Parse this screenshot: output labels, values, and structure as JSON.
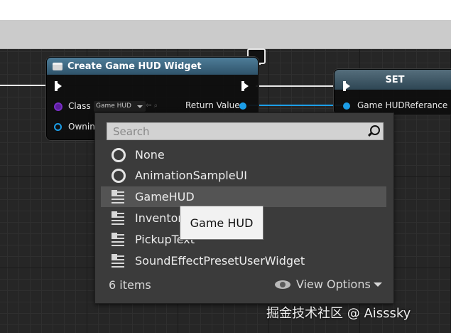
{
  "node_create": {
    "title": "Create Game HUD Widget",
    "class_label": "Class",
    "class_value": "Game HUD",
    "owning_label": "Owning",
    "return_label": "Return Value"
  },
  "node_set": {
    "title": "SET",
    "pin_label": "Game HUDReferance"
  },
  "picker": {
    "search_placeholder": "Search",
    "items": [
      {
        "label": "None",
        "icon": "radio-icon"
      },
      {
        "label": "AnimationSampleUI",
        "icon": "radio-icon"
      },
      {
        "label": "GameHUD",
        "icon": "widget-blueprint-icon"
      },
      {
        "label": "Inventor",
        "icon": "widget-blueprint-icon"
      },
      {
        "label": "PickupText",
        "icon": "widget-blueprint-icon"
      },
      {
        "label": "SoundEffectPresetUserWidget",
        "icon": "widget-blueprint-icon"
      }
    ],
    "count": "6 items",
    "view_options": "View Options"
  },
  "tooltip": {
    "text": "Game HUD"
  },
  "watermark": "掘金技术社区 @ Aisssky",
  "colors": {
    "exec": "#ffffff",
    "object_pin": "#1c9ee8",
    "class_pin": "#5c1e9e",
    "node_header": "#3d6982"
  }
}
